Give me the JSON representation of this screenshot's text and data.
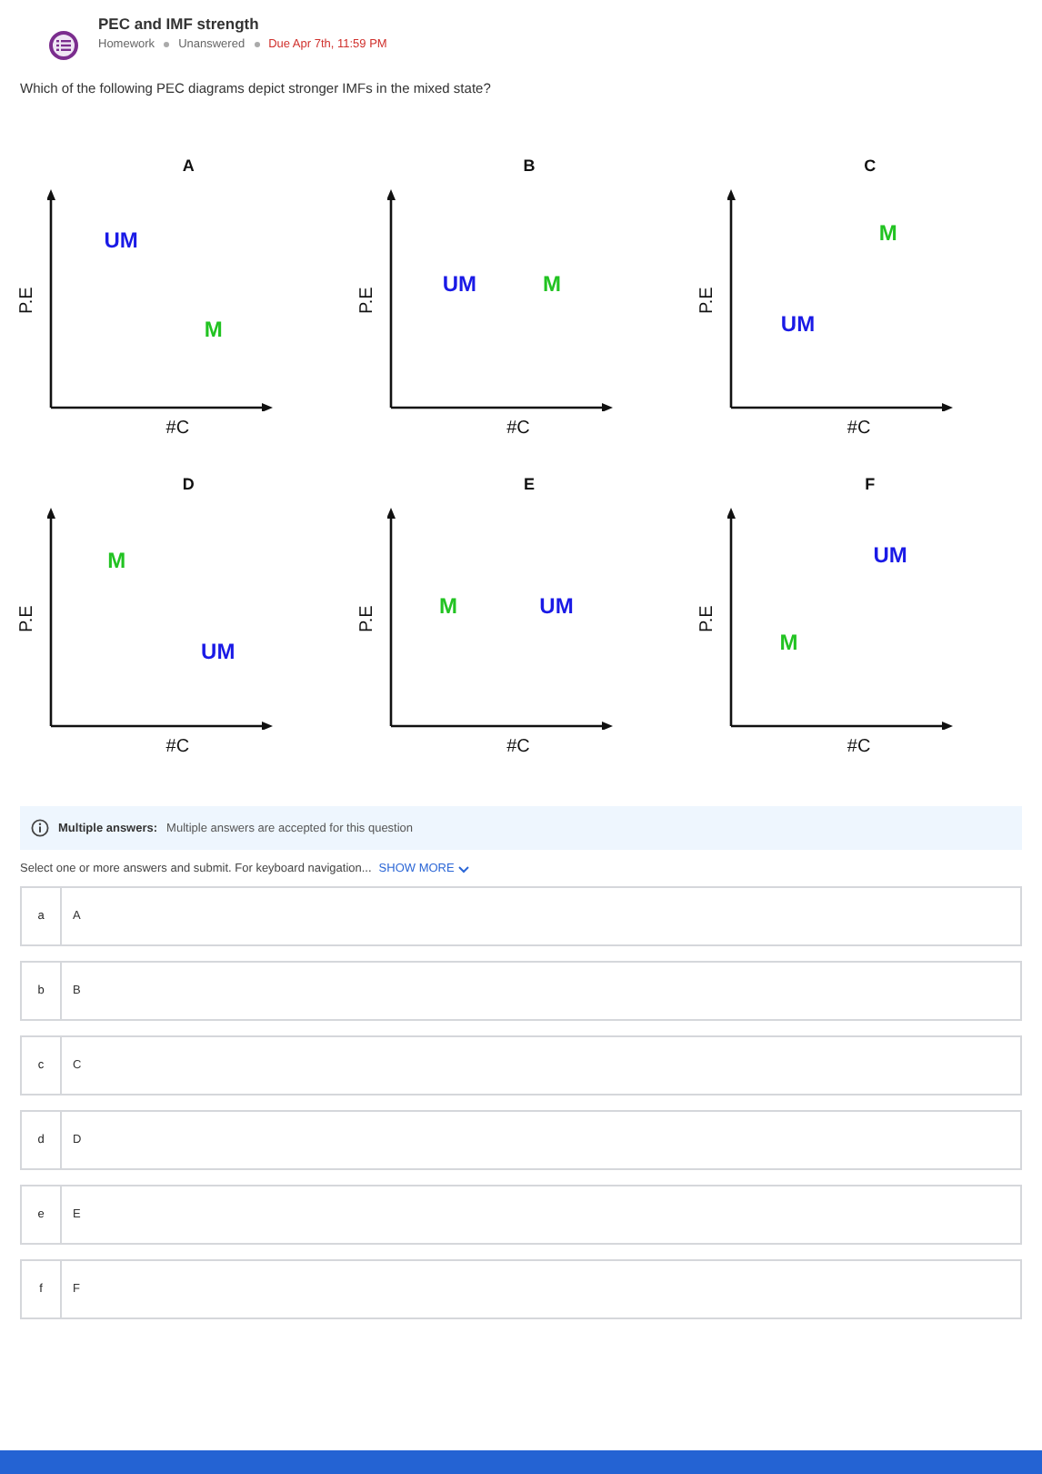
{
  "header": {
    "title": "PEC and IMF strength",
    "type": "Homework",
    "status": "Unanswered",
    "due": "Due Apr 7th, 11:59 PM"
  },
  "question": "Which of the following PEC diagrams depict stronger IMFs in the mixed state?",
  "diagrams": [
    {
      "title": "A",
      "ylabel": "P.E",
      "xlabel": "#C",
      "labels": [
        {
          "text": "UM",
          "kind": "unmixed"
        },
        {
          "text": "M",
          "kind": "mixed"
        }
      ]
    },
    {
      "title": "B",
      "ylabel": "P.E",
      "xlabel": "#C",
      "labels": [
        {
          "text": "UM",
          "kind": "unmixed"
        },
        {
          "text": "M",
          "kind": "mixed"
        }
      ]
    },
    {
      "title": "C",
      "ylabel": "P.E",
      "xlabel": "#C",
      "labels": [
        {
          "text": "M",
          "kind": "mixed"
        },
        {
          "text": "UM",
          "kind": "unmixed"
        }
      ]
    },
    {
      "title": "D",
      "ylabel": "P.E",
      "xlabel": "#C",
      "labels": [
        {
          "text": "M",
          "kind": "mixed"
        },
        {
          "text": "UM",
          "kind": "unmixed"
        }
      ]
    },
    {
      "title": "E",
      "ylabel": "P.E",
      "xlabel": "#C",
      "labels": [
        {
          "text": "M",
          "kind": "mixed"
        },
        {
          "text": "UM",
          "kind": "unmixed"
        }
      ]
    },
    {
      "title": "F",
      "ylabel": "P.E",
      "xlabel": "#C",
      "labels": [
        {
          "text": "UM",
          "kind": "unmixed"
        },
        {
          "text": "M",
          "kind": "mixed"
        }
      ]
    }
  ],
  "info": {
    "label": "Multiple answers:",
    "text": "Multiple answers are accepted for this question"
  },
  "instruction": "Select one or more answers and submit. For keyboard navigation...",
  "show_more": "SHOW MORE",
  "options": [
    {
      "letter": "a",
      "text": "A",
      "selected": false
    },
    {
      "letter": "b",
      "text": "B",
      "selected": false
    },
    {
      "letter": "c",
      "text": "C",
      "selected": false
    },
    {
      "letter": "d",
      "text": "D",
      "selected": false
    },
    {
      "letter": "e",
      "text": "E",
      "selected": false
    },
    {
      "letter": "f",
      "text": "F",
      "selected": false
    }
  ]
}
